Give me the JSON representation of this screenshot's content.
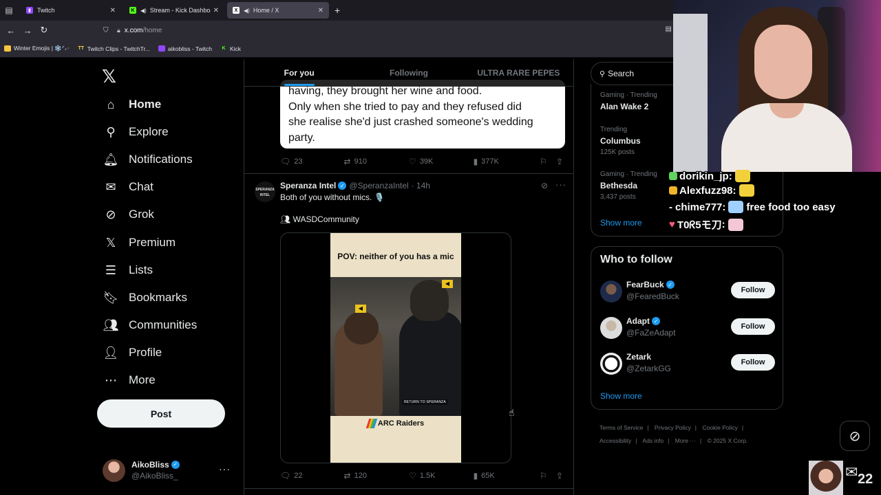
{
  "browser": {
    "tabs": [
      {
        "title": "Twitch",
        "icon_color": "#9146ff",
        "active": false
      },
      {
        "title": "Stream - Kick Dashboard",
        "icon_color": "#53fc18",
        "active": false,
        "audio": true
      },
      {
        "title": "Home / X",
        "icon_color": "#ffffff",
        "active": true,
        "audio": true
      }
    ],
    "url_host": "x.com",
    "url_path": "/home",
    "bookmarks": [
      {
        "label": "Winter Emojis | ❄️ᐟ₊‧",
        "icon": "folder-icon",
        "color": "#f5c542"
      },
      {
        "label": "Twitch Clips - TwitchTr...",
        "icon": "twitchtracker-icon",
        "color": "#ffd54a"
      },
      {
        "label": "aikobliss - Twitch",
        "icon": "twitch-icon",
        "color": "#9146ff"
      },
      {
        "label": "Kick",
        "icon": "kick-icon",
        "color": "#53fc18"
      }
    ]
  },
  "nav": {
    "items": [
      {
        "label": "Home",
        "icon": "home-icon",
        "glyph": "⌂"
      },
      {
        "label": "Explore",
        "icon": "search-icon",
        "glyph": "⚲"
      },
      {
        "label": "Notifications",
        "icon": "bell-icon",
        "glyph": "🔔︎"
      },
      {
        "label": "Chat",
        "icon": "envelope-icon",
        "glyph": "✉"
      },
      {
        "label": "Grok",
        "icon": "grok-icon",
        "glyph": "⊘"
      },
      {
        "label": "Premium",
        "icon": "x-premium-icon",
        "glyph": "𝕏"
      },
      {
        "label": "Lists",
        "icon": "list-icon",
        "glyph": "☰"
      },
      {
        "label": "Bookmarks",
        "icon": "bookmark-icon",
        "glyph": "🔖︎"
      },
      {
        "label": "Communities",
        "icon": "communities-icon",
        "glyph": "👥︎"
      },
      {
        "label": "Profile",
        "icon": "person-icon",
        "glyph": "👤︎"
      },
      {
        "label": "More",
        "icon": "more-circle-icon",
        "glyph": "⋯"
      }
    ],
    "post_label": "Post",
    "account": {
      "name": "AikoBliss",
      "handle": "@AikoBliss_"
    }
  },
  "feed": {
    "tabs": [
      "For you",
      "Following",
      "ULTRA RARE PEPES"
    ],
    "tweet1": {
      "card_lines": [
        "having, they brought her wine and food.",
        "Only when she tried to pay and they refused did",
        "she realise she'd just crashed someone's wedding",
        "party."
      ],
      "replies": "23",
      "reposts": "910",
      "likes": "39K",
      "views": "377K"
    },
    "tweet2": {
      "avatar_text": "SPERANZA INTEL",
      "name": "Speranza Intel",
      "handle": "@SperanzaIntel",
      "time": "· 14h",
      "text": "Both of you without mics. 🎙️",
      "tag": "WASDCommunity",
      "video_caption": "POV: neither of you has a mic",
      "video_overlay": "RETURN TO SPERANZA",
      "video_brand": "ARC Raiders",
      "replies": "22",
      "reposts": "120",
      "likes": "1.5K",
      "views": "65K"
    }
  },
  "sidebar": {
    "search_placeholder": "Search",
    "trends": [
      {
        "category": "Gaming · Trending",
        "topic": "Alan Wake 2",
        "count": ""
      },
      {
        "category": "Trending",
        "topic": "Columbus",
        "count": "125K posts"
      },
      {
        "category": "Gaming · Trending",
        "topic": "Bethesda",
        "count": "3,437 posts"
      }
    ],
    "show_more": "Show more",
    "who_to_follow": {
      "title": "Who to follow",
      "accounts": [
        {
          "name": "FearBuck",
          "handle": "@FearedBuck",
          "button": "Follow"
        },
        {
          "name": "Adapt",
          "handle": "@FaZeAdapt",
          "button": "Follow"
        },
        {
          "name": "Zetark",
          "handle": "@ZetarkGG",
          "button": "Follow"
        }
      ],
      "show_more": "Show more"
    },
    "footer": [
      "Terms of Service",
      "Privacy Policy",
      "Cookie Policy",
      "Accessibility",
      "Ads info",
      "More ···",
      "© 2025 X Corp."
    ]
  },
  "overlay": {
    "chat": [
      {
        "user": "dorikin_jp",
        "message": "",
        "color": "#5fd35f"
      },
      {
        "user": "Alexfuzz98",
        "message": "",
        "color": "#f0b429"
      },
      {
        "user": "chime777",
        "message": "free food too easy",
        "color": "#8fd3ff"
      },
      {
        "user": "T0ᖇ5モ刀",
        "message": "",
        "color": "#ff5a7a"
      }
    ],
    "message_count": "22"
  }
}
